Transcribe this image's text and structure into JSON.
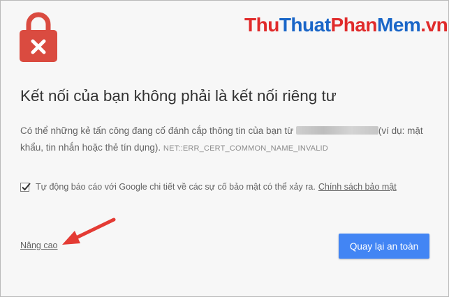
{
  "watermark": {
    "parts": [
      {
        "text": "Thu",
        "color": "#e02b2b"
      },
      {
        "text": "Thuat",
        "color": "#1a66c8"
      },
      {
        "text": "Phan",
        "color": "#e02b2b"
      },
      {
        "text": "Mem",
        "color": "#1a66c8"
      },
      {
        "text": ".vn",
        "color": "#e02b2b"
      }
    ]
  },
  "icons": {
    "lock": "lock-error-icon",
    "checkbox": "checkmark-icon",
    "arrow": "red-arrow-annotation"
  },
  "colors": {
    "lock_red": "#da4b40",
    "button_blue": "#4285f4",
    "arrow_red": "#e43b34",
    "text_gray": "#646464"
  },
  "page": {
    "title": "Kết nối của bạn không phải là kết nối riêng tư",
    "description_before": "Có thể những kẻ tấn công đang cố đánh cắp thông tin của bạn từ ",
    "description_after": "(ví dụ: mật khẩu, tin nhắn hoặc thẻ tín dụng).",
    "error_code": "NET::ERR_CERT_COMMON_NAME_INVALID"
  },
  "report": {
    "checked": true,
    "text": "Tự động báo cáo với Google chi tiết về các sự cố bảo mật có thể xảy ra.",
    "policy_link": "Chính sách bảo mật"
  },
  "actions": {
    "advanced": "Nâng cao",
    "back_to_safety": "Quay lại an toàn"
  }
}
